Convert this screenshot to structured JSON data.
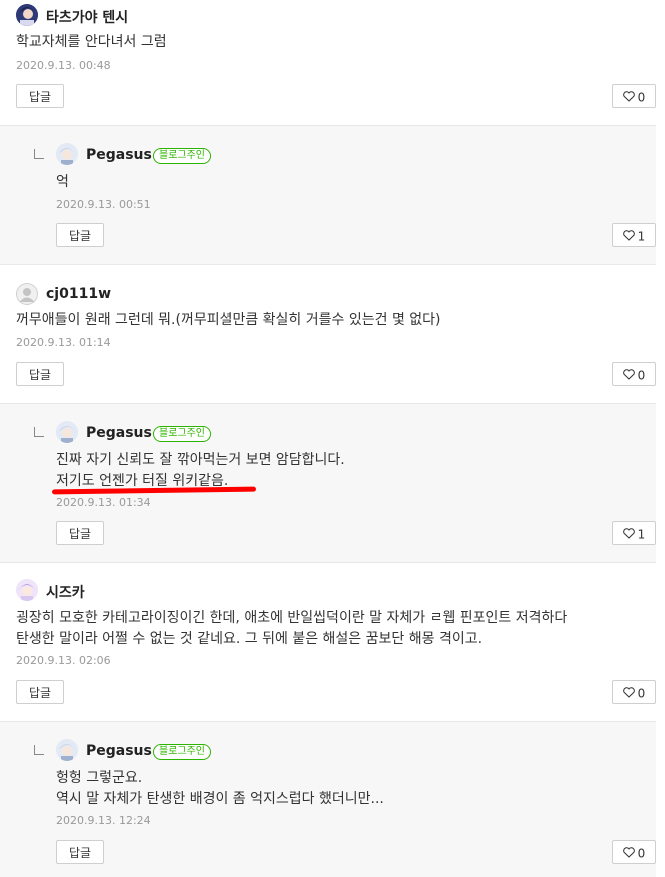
{
  "common": {
    "reply_label": "답글",
    "owner_badge": "블로그주인"
  },
  "comments": [
    {
      "author": "타츠가야 텐시",
      "lines": [
        "학교자체를 안다녀서 그럼"
      ],
      "date": "2020.9.13. 00:48",
      "likes": "0",
      "reply": {
        "author": "Pegasus",
        "lines": [
          "억"
        ],
        "date": "2020.9.13. 00:51",
        "likes": "1"
      }
    },
    {
      "author": "cj0111w",
      "lines": [
        "꺼무애들이 원래 그런데 뭐.(꺼무피셜만큼 확실히 거를수 있는건 몇 없다)"
      ],
      "date": "2020.9.13. 01:14",
      "likes": "0",
      "reply": {
        "author": "Pegasus",
        "lines": [
          "진짜 자기 신뢰도 잘 깎아먹는거 보면 암담합니다.",
          "저기도 언젠가 터질 위키같음."
        ],
        "date": "2020.9.13. 01:34",
        "likes": "1"
      }
    },
    {
      "author": "시즈카",
      "lines": [
        "굉장히 모호한 카테고라이징이긴 한데, 애초에 반일씹덕이란 말 자체가 ㄹ웹 핀포인트 저격하다",
        "탄생한 말이라 어쩔 수 없는 것 같네요. 그 뒤에 붙은 해설은 꿈보단 해몽 격이고."
      ],
      "date": "2020.9.13. 02:06",
      "likes": "0",
      "reply": {
        "author": "Pegasus",
        "lines": [
          "헝헝 그렇군요.",
          "역시 말 자체가 탄생한 배경이 좀 억지스럽다 했더니만..."
        ],
        "date": "2020.9.13. 12:24",
        "likes": "0"
      }
    }
  ]
}
